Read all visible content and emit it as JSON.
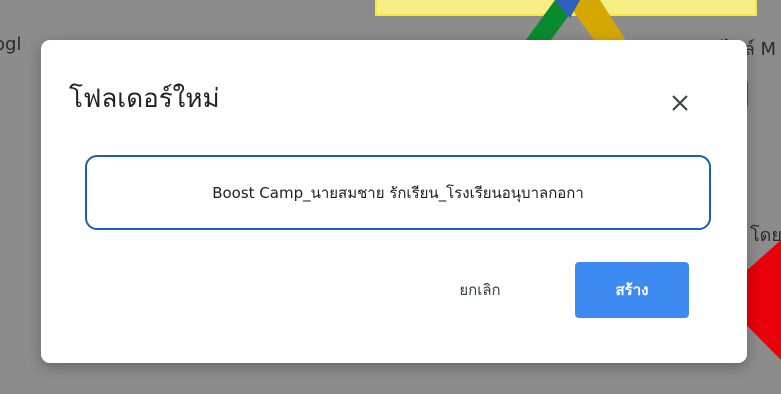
{
  "background": {
    "left_text": "ogl",
    "right_text": "ไฟล์ M",
    "right_text_2": "โดย"
  },
  "dialog": {
    "title": "โฟลเดอร์ใหม่",
    "close_symbol": "×",
    "folder_name_value": "Boost Camp_นายสมชาย รักเรียน_โรงเรียนอนุบาลกอกา",
    "cancel_label": "ยกเลิก",
    "create_label": "สร้าง"
  },
  "colors": {
    "accent": "#3d8bf0",
    "input_border": "#1a5fb4",
    "annotation_arrow": "#e8000a",
    "highlight": "#f6ef86"
  },
  "icons": [
    "close-icon",
    "google-drive-logo",
    "red-arrow-annotation"
  ]
}
